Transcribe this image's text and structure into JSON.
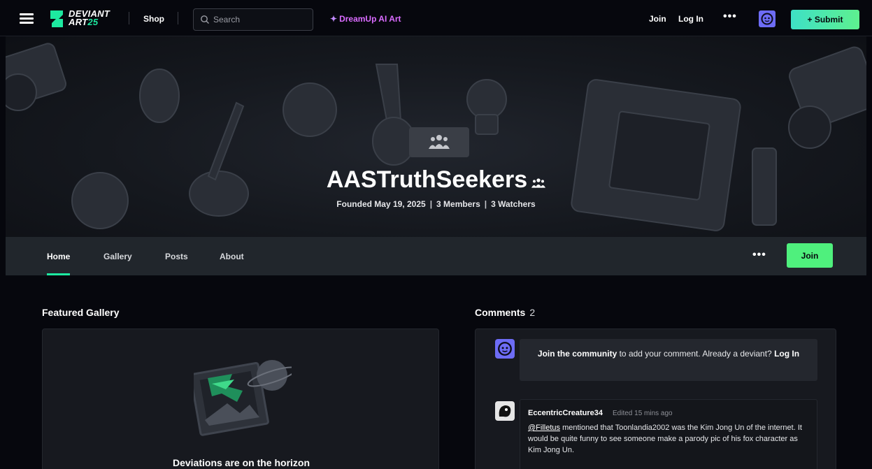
{
  "topbar": {
    "shop": "Shop",
    "search_placeholder": "Search",
    "dreamup": "DreamUp AI Art",
    "join": "Join",
    "login": "Log In",
    "submit": "+ Submit",
    "logo_line1": "DEVIANT",
    "logo_line2_a": "ART",
    "logo_line2_b": "25"
  },
  "group": {
    "name": "AASTruthSeekers",
    "founded": "Founded May 19, 2025",
    "members": "3 Members",
    "watchers": "3 Watchers"
  },
  "tabs": [
    "Home",
    "Gallery",
    "Posts",
    "About"
  ],
  "active_tab": "Home",
  "tabs_join": "Join",
  "featured": {
    "title": "Featured Gallery",
    "empty_message": "Deviations are on the horizon"
  },
  "comments": {
    "title": "Comments",
    "count": "2",
    "join_bold": "Join the community",
    "join_rest": " to add your comment. Already a deviant? ",
    "login_bold": "Log In",
    "items": [
      {
        "author": "EccentricCreature34",
        "edited": "Edited 15 mins ago",
        "mention": "@Filletus",
        "text": " mentioned that Toonlandia2002 was the Kim Jong Un of the internet. It would be quite funny to see someone make a parody pic of his fox character as Kim Jong Un."
      }
    ]
  },
  "colors": {
    "accent_green": "#1de9a0",
    "join_green": "#4ff07d",
    "dreamup_purple": "#d96bff",
    "avatar_purple": "#6d6cf5"
  }
}
